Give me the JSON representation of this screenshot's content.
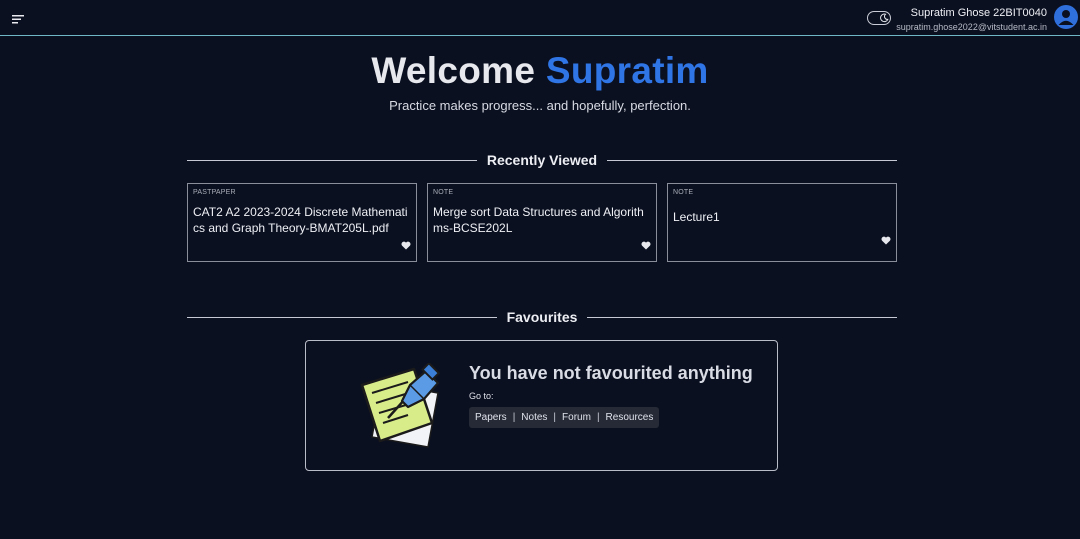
{
  "header": {
    "user_name": "Supratim Ghose 22BIT0040",
    "user_email": "supratim.ghose2022@vitstudent.ac.in"
  },
  "hero": {
    "welcome": "Welcome",
    "name": "Supratim",
    "subtitle": "Practice makes progress... and hopefully, perfection."
  },
  "recently_viewed": {
    "heading": "Recently Viewed",
    "items": [
      {
        "type": "PASTPAPER",
        "title": "CAT2 A2 2023-2024 Discrete Mathematics and Graph Theory-BMAT205L.pdf"
      },
      {
        "type": "NOTE",
        "title": "Merge sort Data Structures and Algorithms-BCSE202L"
      },
      {
        "type": "NOTE",
        "title": "Lecture1"
      }
    ]
  },
  "favourites": {
    "heading": "Favourites",
    "empty_title": "You have not favourited anything",
    "goto_label": "Go to:",
    "links": [
      "Papers",
      "Notes",
      "Forum",
      "Resources"
    ],
    "separator": "|"
  },
  "colors": {
    "background": "#0b1020",
    "accent": "#2f75e5",
    "topbar_border": "#6fb7c7"
  }
}
